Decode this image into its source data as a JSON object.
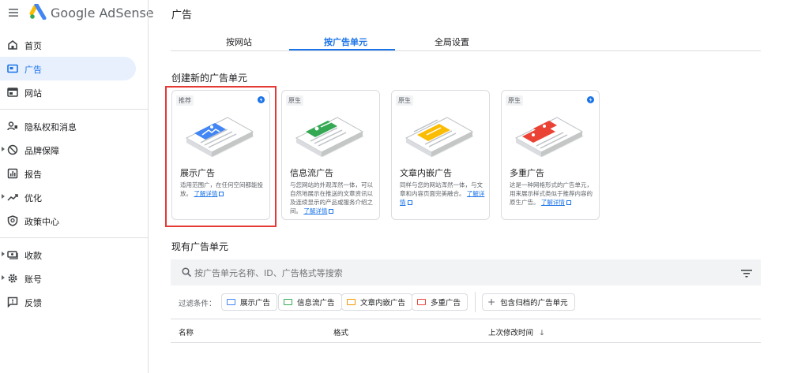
{
  "app": {
    "brand": "Google AdSense",
    "page_title": "广告"
  },
  "sidebar": {
    "items": [
      {
        "label": "首页",
        "icon": "home-icon",
        "active": false,
        "expandable": false
      },
      {
        "label": "广告",
        "icon": "ads-icon",
        "active": true,
        "expandable": false
      },
      {
        "label": "网站",
        "icon": "sites-icon",
        "active": false,
        "expandable": false
      },
      {
        "label": "隐私权和消息",
        "icon": "privacy-icon",
        "active": false,
        "expandable": false
      },
      {
        "label": "品牌保障",
        "icon": "block-icon",
        "active": false,
        "expandable": true
      },
      {
        "label": "报告",
        "icon": "reports-icon",
        "active": false,
        "expandable": false
      },
      {
        "label": "优化",
        "icon": "trend-icon",
        "active": false,
        "expandable": true
      },
      {
        "label": "政策中心",
        "icon": "policy-icon",
        "active": false,
        "expandable": false
      },
      {
        "label": "收款",
        "icon": "payments-icon",
        "active": false,
        "expandable": true
      },
      {
        "label": "账号",
        "icon": "gear-icon",
        "active": false,
        "expandable": true
      },
      {
        "label": "反馈",
        "icon": "feedback-icon",
        "active": false,
        "expandable": false
      }
    ]
  },
  "tabs": [
    {
      "label": "按网站",
      "active": false
    },
    {
      "label": "按广告单元",
      "active": true
    },
    {
      "label": "全局设置",
      "active": false
    }
  ],
  "create": {
    "title": "创建新的广告单元",
    "cards": [
      {
        "badge": "推荐",
        "bolt": true,
        "title": "展示广告",
        "desc": "适用范围广，在任何空间都能投放。",
        "link": "了解详情",
        "accent": "#4285f4"
      },
      {
        "badge": "原生",
        "bolt": false,
        "title": "信息流广告",
        "desc": "与您网站的外观浑然一体，可以自然地展示在推送的文章资讯以及连续显示的产品或服务介绍之间。",
        "link": "了解详情",
        "accent": "#34a853"
      },
      {
        "badge": "原生",
        "bolt": false,
        "title": "文章内嵌广告",
        "desc": "同样与您的网站浑然一体，与文章和内容页面完美融合。",
        "link": "了解详情",
        "accent": "#fbbc04"
      },
      {
        "badge": "原生",
        "bolt": true,
        "title": "多重广告",
        "desc": "这是一种网格形式的广告单元，用来展示样式类似于推荐内容的原生广告。",
        "link": "了解详情",
        "accent": "#ea4335"
      }
    ]
  },
  "existing": {
    "title": "现有广告单元",
    "search_placeholder": "按广告单元名称、ID、广告格式等搜索",
    "filter_label": "过滤条件：",
    "chips": [
      {
        "label": "展示广告",
        "color": "#4285f4"
      },
      {
        "label": "信息流广告",
        "color": "#34a853"
      },
      {
        "label": "文章内嵌广告",
        "color": "#f29900"
      },
      {
        "label": "多重广告",
        "color": "#ea4335"
      }
    ],
    "archived_chip": "包含归档的广告单元",
    "columns": [
      "名称",
      "格式",
      "上次修改时间"
    ],
    "sort_indicator": "↓"
  }
}
